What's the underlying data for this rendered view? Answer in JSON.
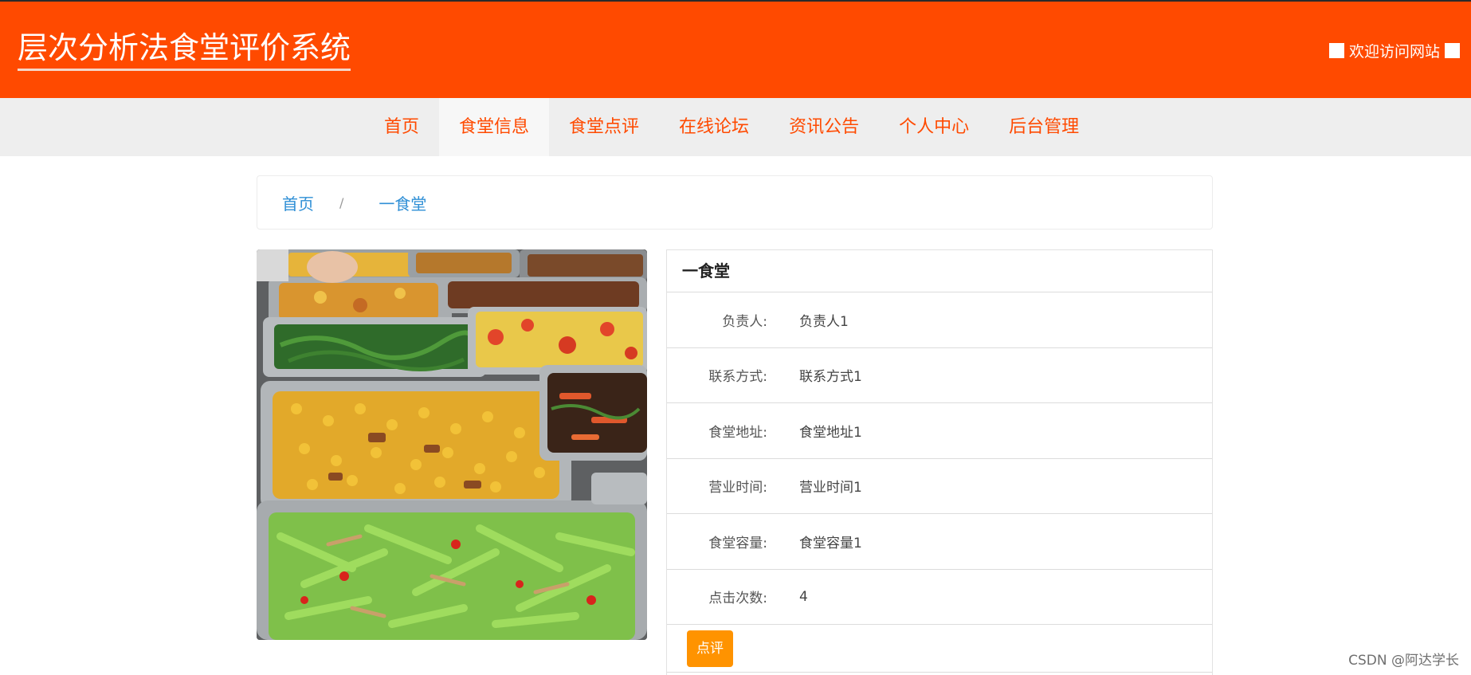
{
  "header": {
    "site_title": "层次分析法食堂评价系统",
    "welcome": "欢迎访问网站"
  },
  "nav": {
    "items": [
      {
        "label": "首页"
      },
      {
        "label": "食堂信息"
      },
      {
        "label": "食堂点评"
      },
      {
        "label": "在线论坛"
      },
      {
        "label": "资讯公告"
      },
      {
        "label": "个人中心"
      },
      {
        "label": "后台管理"
      }
    ],
    "active": "食堂信息"
  },
  "breadcrumb": {
    "home": "首页",
    "separator": "/",
    "current": "一食堂"
  },
  "detail": {
    "title": "一食堂",
    "fields": [
      {
        "label": "负责人:",
        "value": "负责人1"
      },
      {
        "label": "联系方式:",
        "value": "联系方式1"
      },
      {
        "label": "食堂地址:",
        "value": "食堂地址1"
      },
      {
        "label": "营业时间:",
        "value": "营业时间1"
      },
      {
        "label": "食堂容量:",
        "value": "食堂容量1"
      },
      {
        "label": "点击次数:",
        "value": "4"
      }
    ],
    "review_button": "点评"
  },
  "watermark": "CSDN @阿达学长",
  "colors": {
    "brand": "#ff4a00",
    "button": "#ff9300",
    "link": "#2f8fd6"
  }
}
